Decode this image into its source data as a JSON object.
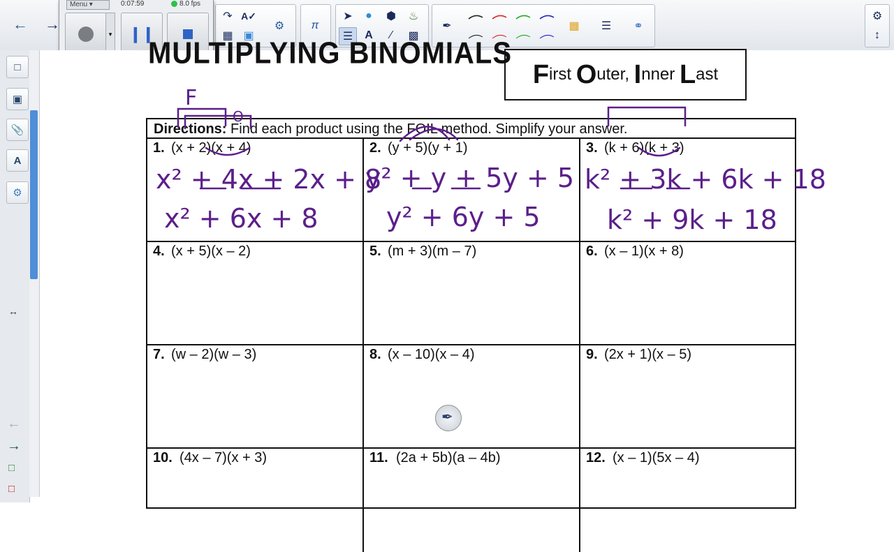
{
  "toolbar": {
    "recorder": {
      "menu_label": "Menu",
      "elapsed": "0:07:59",
      "fps": "8.0 fps"
    },
    "icons": [
      "back-arrow-icon",
      "forward-arrow-icon",
      "record-icon",
      "pause-icon",
      "stop-icon",
      "undo-icon",
      "spellcheck-icon",
      "table-icon",
      "insert-icon",
      "math-pi-icon",
      "select-pointer-icon",
      "shape-icon",
      "fill-icon",
      "highlighter-icon",
      "text-icon",
      "line-icon",
      "eraser-icon",
      "pen-icon",
      "ink-styles-icon",
      "color-palette-icon",
      "line-props-icon",
      "layers-icon",
      "settings-gear-icon",
      "expand-arrows-icon"
    ]
  },
  "worksheet": {
    "title": "MULTIPLYING BINOMIALS",
    "foil": {
      "first_big": "F",
      "first_rest": "irst",
      "outer_big": "O",
      "outer_rest": "uter,",
      "inner_big": "I",
      "inner_rest": "nner",
      "last_big": "L",
      "last_rest": "ast"
    },
    "directions_label": "Directions:",
    "directions_text": "Find each product using the FOIL method.  Simplify your answer.",
    "problems": [
      {
        "num": "1.",
        "expr": "(x + 2)(x + 4)"
      },
      {
        "num": "2.",
        "expr": "(y + 5)(y + 1)"
      },
      {
        "num": "3.",
        "expr": "(k + 6)(k + 3)"
      },
      {
        "num": "4.",
        "expr": "(x + 5)(x – 2)"
      },
      {
        "num": "5.",
        "expr": "(m + 3)(m – 7)"
      },
      {
        "num": "6.",
        "expr": "(x – 1)(x + 8)"
      },
      {
        "num": "7.",
        "expr": "(w – 2)(w – 3)"
      },
      {
        "num": "8.",
        "expr": "(x – 10)(x – 4)"
      },
      {
        "num": "9.",
        "expr": "(2x + 1)(x – 5)"
      },
      {
        "num": "10.",
        "expr": "(4x – 7)(x + 3)"
      },
      {
        "num": "11.",
        "expr": "(2a + 5b)(a – 4b)"
      },
      {
        "num": "12.",
        "expr": "(x – 1)(5x – 4)"
      }
    ],
    "handwriting": {
      "ink_color": "#5b1f8a",
      "p1_label_f": "F",
      "p1_label_o": "O",
      "p1_line1": "x² + 4x + 2x + 8",
      "p1_line2": "x² + 6x + 8",
      "p2_line1": "y² + y + 5y + 5",
      "p2_line2": "y² + 6y + 5",
      "p3_line1": "k² + 3k + 6k + 18",
      "p3_line2": "k² + 9k + 18"
    }
  }
}
